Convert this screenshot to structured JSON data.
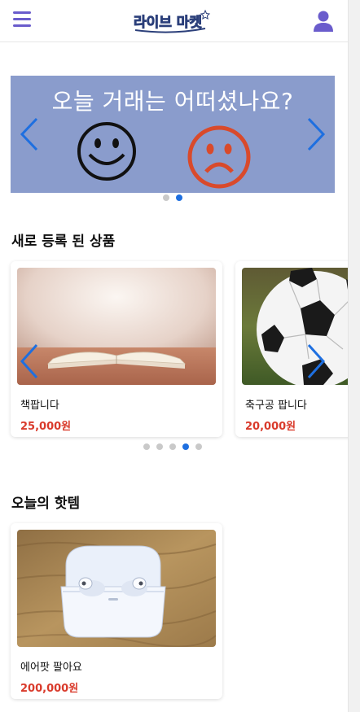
{
  "header": {
    "logo_text": "라이브 마켓"
  },
  "banner": {
    "text": "오늘 거래는 어떠셨나요?",
    "slide_count": 2,
    "active_slide": 2
  },
  "new_products": {
    "title": "새로 등록 된 상품",
    "items": [
      {
        "name": "책팝니다",
        "price": "25,000원",
        "image": "book-photo"
      },
      {
        "name": "축구공 팝니다",
        "price": "20,000원",
        "image": "soccer-ball-photo"
      }
    ],
    "slide_count": 5,
    "active_slide": 4
  },
  "hot_items": {
    "title": "오늘의 핫템",
    "items": [
      {
        "name": "에어팟 팔아요",
        "price": "200,000원",
        "image": "airpods-photo"
      }
    ]
  },
  "colors": {
    "accent": "#6a5ccc",
    "banner_bg": "#8a9ccc",
    "price": "#d93a2b",
    "arrow": "#1e6fe0"
  }
}
